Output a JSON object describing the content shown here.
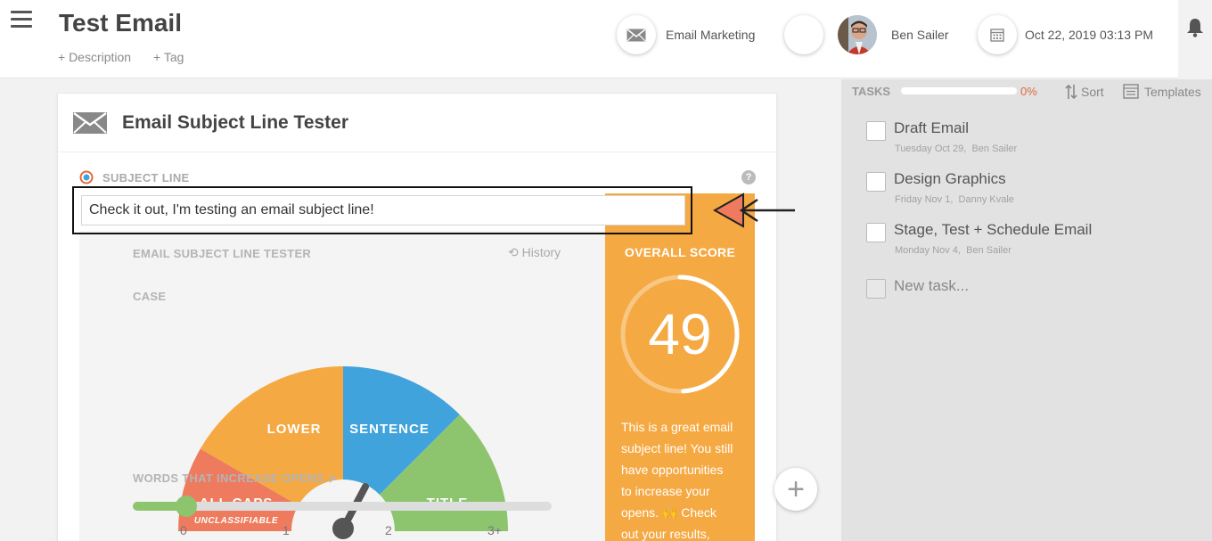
{
  "header": {
    "title": "Test Email",
    "description_link": "+ Description",
    "tag_link": "+ Tag",
    "category": "Email Marketing",
    "assignee": "Ben Sailer",
    "date": "Oct 22, 2019 03:13 PM"
  },
  "tester": {
    "card_title": "Email Subject Line Tester",
    "subject_label": "SUBJECT LINE",
    "subject_value": "Check it out, I'm testing an email subject line!",
    "panel_title": "EMAIL SUBJECT LINE TESTER",
    "history_label": "History",
    "case_label": "CASE",
    "gauge": {
      "all_caps": "ALL CAPS",
      "unclassifiable": "UNCLASSIFIABLE",
      "lower": "LOWER",
      "sentence": "SENTENCE",
      "title": "TITLE",
      "selected": "SENTENCE"
    },
    "words_label": "WORDS THAT INCREASE OPENS",
    "slider": {
      "value": 0,
      "ticks": [
        "0",
        "1",
        "2",
        "3+"
      ]
    },
    "overall_label": "OVERALL SCORE",
    "overall_score": "49",
    "score_fraction": 0.49,
    "score_message_lines": [
      "This is a great email",
      "subject line! You still",
      "have opportunities",
      "to increase your",
      "opens. 🙌 Check",
      "out your results,"
    ]
  },
  "tasks": {
    "label": "TASKS",
    "progress_pct": "0%",
    "sort_label": "Sort",
    "templates_label": "Templates",
    "items": [
      {
        "title": "Draft Email",
        "date": "Tuesday Oct 29,",
        "assignee": "Ben Sailer"
      },
      {
        "title": "Design Graphics",
        "date": "Friday Nov 1,",
        "assignee": "Danny Kvale"
      },
      {
        "title": "Stage, Test + Schedule Email",
        "date": "Monday Nov 4,",
        "assignee": "Ben Sailer"
      }
    ],
    "new_task_placeholder": "New task..."
  },
  "colors": {
    "all_caps": "#ee7b5e",
    "lower": "#f5a943",
    "sentence": "#41a3db",
    "title": "#8dc46e",
    "score_panel": "#f5a943",
    "progress_pct": "#e3683a"
  }
}
